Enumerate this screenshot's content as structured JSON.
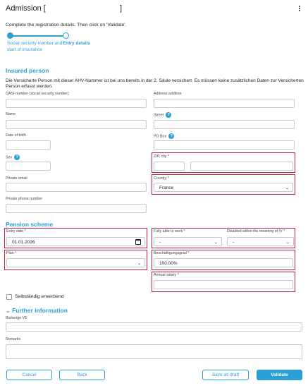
{
  "header": {
    "title": "Admission [",
    "title_close": "]"
  },
  "instructions": "Complete the registration details. Then click on 'Validate'.",
  "stepper": {
    "steps": [
      {
        "label": "Social security number and start of insurance",
        "state": "done"
      },
      {
        "label": "Entry details",
        "state": "current"
      }
    ]
  },
  "insured": {
    "heading": "Insured person",
    "note": "Die Versicherte Person mit dieser AHV-Nummer ist bei uns bereits in der 2. Säule versichert. Es müssen keine zusätzlichen Daten zur Versicherten Person erfasst werden.",
    "oasi_label": "OASI number (social security number)",
    "address_addition_label": "Address addition",
    "name_label": "Name",
    "street_label": "Street",
    "dob_label": "Date of birth",
    "pobox_label": "PO Box",
    "sex_label": "Sex",
    "zip_label": "ZIP, city *",
    "email_label": "Private email",
    "country_label": "Country *",
    "country_value": "France",
    "phone_label": "Private phone number"
  },
  "pension": {
    "heading": "Pension scheme",
    "entry_label": "Entry date *",
    "entry_value": "01.01.2026",
    "fully_able_label": "Fully able to work *",
    "fully_able_value": "-",
    "disabled_label": "Disabled within the meaning of IV *",
    "disabled_value": "-",
    "plan_label": "Plan *",
    "plan_value": "",
    "grade_label": "Beschäftigungsgrad *",
    "grade_value": "100.00%",
    "salary_label": "Annual salary *",
    "self_employed_label": "Selbständig erwerbend"
  },
  "further": {
    "heading": "Further information",
    "prev_ve_label": "Bisherige VE",
    "remarks_label": "Remarks"
  },
  "buttons": {
    "cancel": "Cancel",
    "back": "Back",
    "save_draft": "Save as draft",
    "validate": "Validate"
  },
  "colors": {
    "accent": "#2a9fd6",
    "error_border": "#c4243a"
  }
}
